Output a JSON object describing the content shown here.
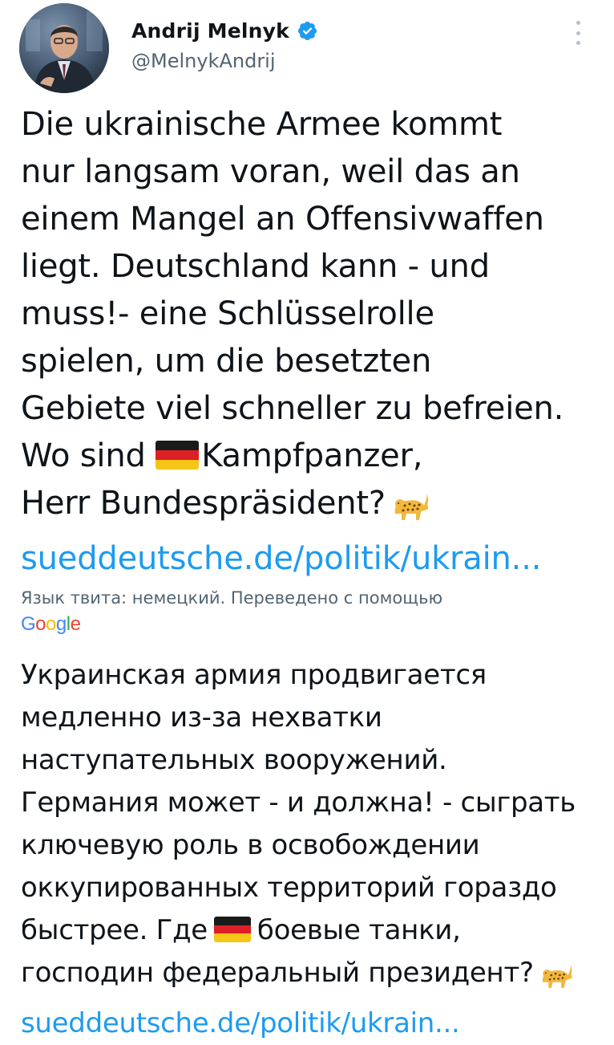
{
  "author": {
    "display_name": "Andrij Melnyk",
    "handle": "@MelnykAndrij",
    "verified": true
  },
  "tweet_de": {
    "lines": [
      "Die ukrainische Armee kommt",
      "nur langsam voran, weil das an",
      "einem Mangel an Offensivwaffen",
      "liegt. Deutschland kann - und",
      "muss!- eine Schlüsselrolle",
      "spielen, um die besetzten",
      "Gebiete viel schneller zu befreien."
    ],
    "line8_before": "Wo sind ",
    "line8_after": "Kampfpanzer,",
    "line9": "Herr Bundespräsident?",
    "link": "sueddeutsche.de/politik/ukrain..."
  },
  "translation": {
    "note": "Язык твита: немецкий. Переведено с помощью",
    "provider": "Google"
  },
  "tweet_ru": {
    "lines": [
      "Украинская армия продвигается",
      "медленно из-за нехватки",
      "наступательных вооружений.",
      "Германия может - и должна! - сыграть",
      "ключевую роль в освобождении",
      "оккупированных территорий гораздо"
    ],
    "line7_before": "быстрее. Где",
    "line7_after": "боевые танки,",
    "line8": "господин федеральный президент?",
    "link": "sueddeutsche.de/politik/ukrain..."
  },
  "colors": {
    "text": "#0f1419",
    "secondary": "#536471",
    "link": "#1d9bf0",
    "verified": "#1d9bf0"
  },
  "icons": {
    "verified": "verified-badge-icon",
    "more": "more-options-icon",
    "flag": "german-flag-emoji",
    "leopard": "leopard-emoji"
  }
}
